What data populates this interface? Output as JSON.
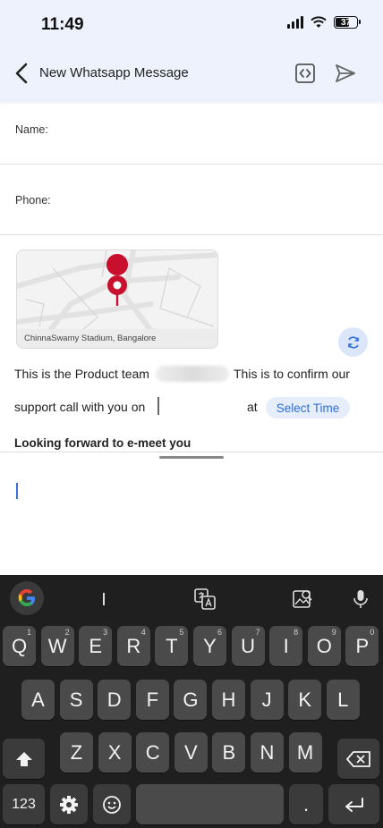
{
  "status": {
    "time": "11:49",
    "battery": "37"
  },
  "header": {
    "title": "New Whatsapp Message"
  },
  "form": {
    "name_label": "Name:",
    "phone_label": "Phone:"
  },
  "map": {
    "caption": "ChinnaSwamy Stadium, Bangalore"
  },
  "message": {
    "line1_a": "This is the Product team",
    "line1_b": "This is to confirm our",
    "line2_a": "support call with you on",
    "line2_at": "at",
    "select_time": "Select Time",
    "line3": "Looking forward to e-meet you"
  },
  "keyboard": {
    "row1": [
      {
        "k": "Q",
        "n": "1"
      },
      {
        "k": "W",
        "n": "2"
      },
      {
        "k": "E",
        "n": "3"
      },
      {
        "k": "R",
        "n": "4"
      },
      {
        "k": "T",
        "n": "5"
      },
      {
        "k": "Y",
        "n": "6"
      },
      {
        "k": "U",
        "n": "7"
      },
      {
        "k": "I",
        "n": "8"
      },
      {
        "k": "O",
        "n": "9"
      },
      {
        "k": "P",
        "n": "0"
      }
    ],
    "row2": [
      "A",
      "S",
      "D",
      "F",
      "G",
      "H",
      "J",
      "K",
      "L"
    ],
    "row3": [
      "Z",
      "X",
      "C",
      "V",
      "B",
      "N",
      "M"
    ],
    "numbers_label": "123",
    "period_label": "."
  },
  "colors": {
    "accent": "#2d6ed8",
    "pin": "#c8102e",
    "header_bg": "#eef2fc",
    "keyboard_bg": "#1f1f1f"
  }
}
